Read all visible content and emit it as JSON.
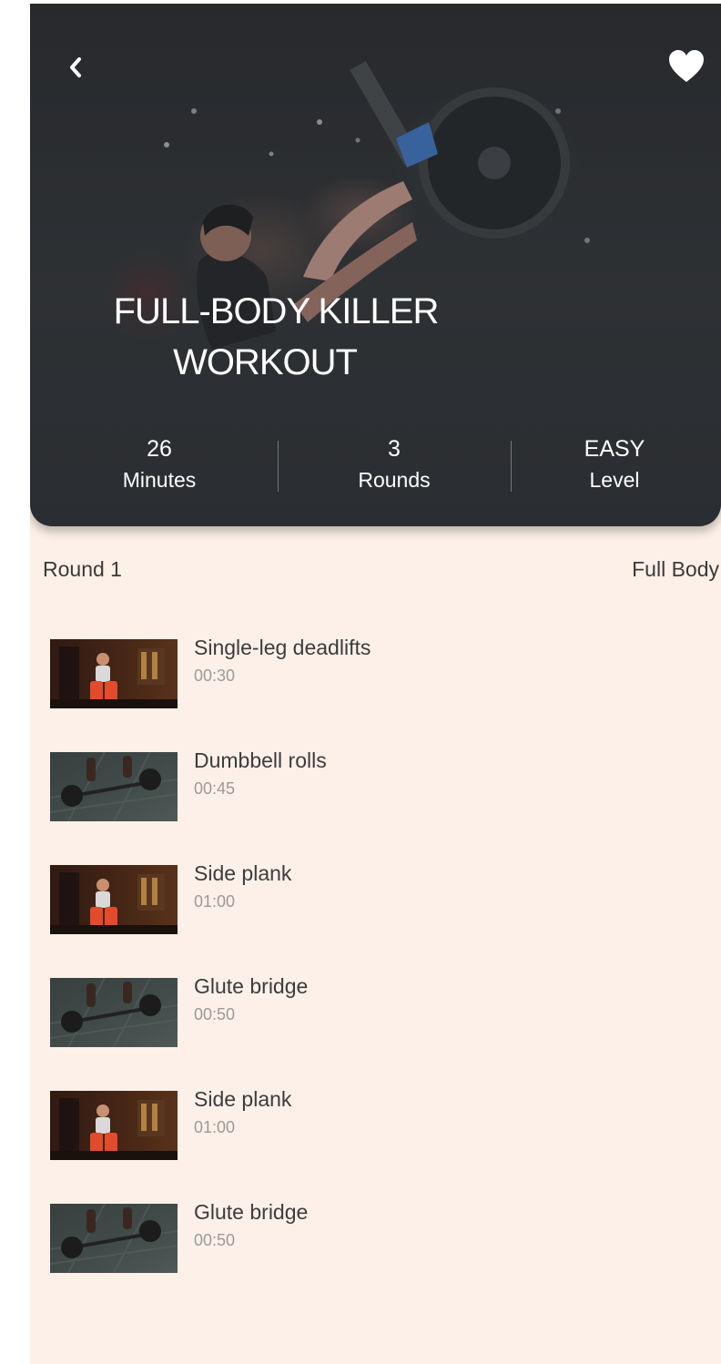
{
  "colors": {
    "screen_bg": "#fdf0e8",
    "hero_bg": "#2e3236",
    "title_text": "#ffffff",
    "body_text": "#3c3c3c",
    "muted_text": "#9a9a9a"
  },
  "header": {
    "back_icon": "chevron-left-icon",
    "favorite_icon": "heart-icon"
  },
  "workout": {
    "title_line1": "FULL-BODY KILLER",
    "title_line2": "WORKOUT"
  },
  "stats": [
    {
      "value": "26",
      "label": "Minutes"
    },
    {
      "value": "3",
      "label": "Rounds"
    },
    {
      "value": "EASY",
      "label": "Level"
    }
  ],
  "round": {
    "title": "Round 1",
    "category": "Full Body"
  },
  "exercises": [
    {
      "name": "Single-leg deadlifts",
      "time": "00:30",
      "thumb": "gym-athlete-thumbnail"
    },
    {
      "name": "Dumbbell rolls",
      "time": "00:45",
      "thumb": "barbell-floor-thumbnail"
    },
    {
      "name": "Side plank",
      "time": "01:00",
      "thumb": "gym-athlete-thumbnail"
    },
    {
      "name": "Glute bridge",
      "time": "00:50",
      "thumb": "barbell-floor-thumbnail"
    },
    {
      "name": "Side plank",
      "time": "01:00",
      "thumb": "gym-athlete-thumbnail"
    },
    {
      "name": "Glute bridge",
      "time": "00:50",
      "thumb": "barbell-floor-thumbnail"
    }
  ]
}
